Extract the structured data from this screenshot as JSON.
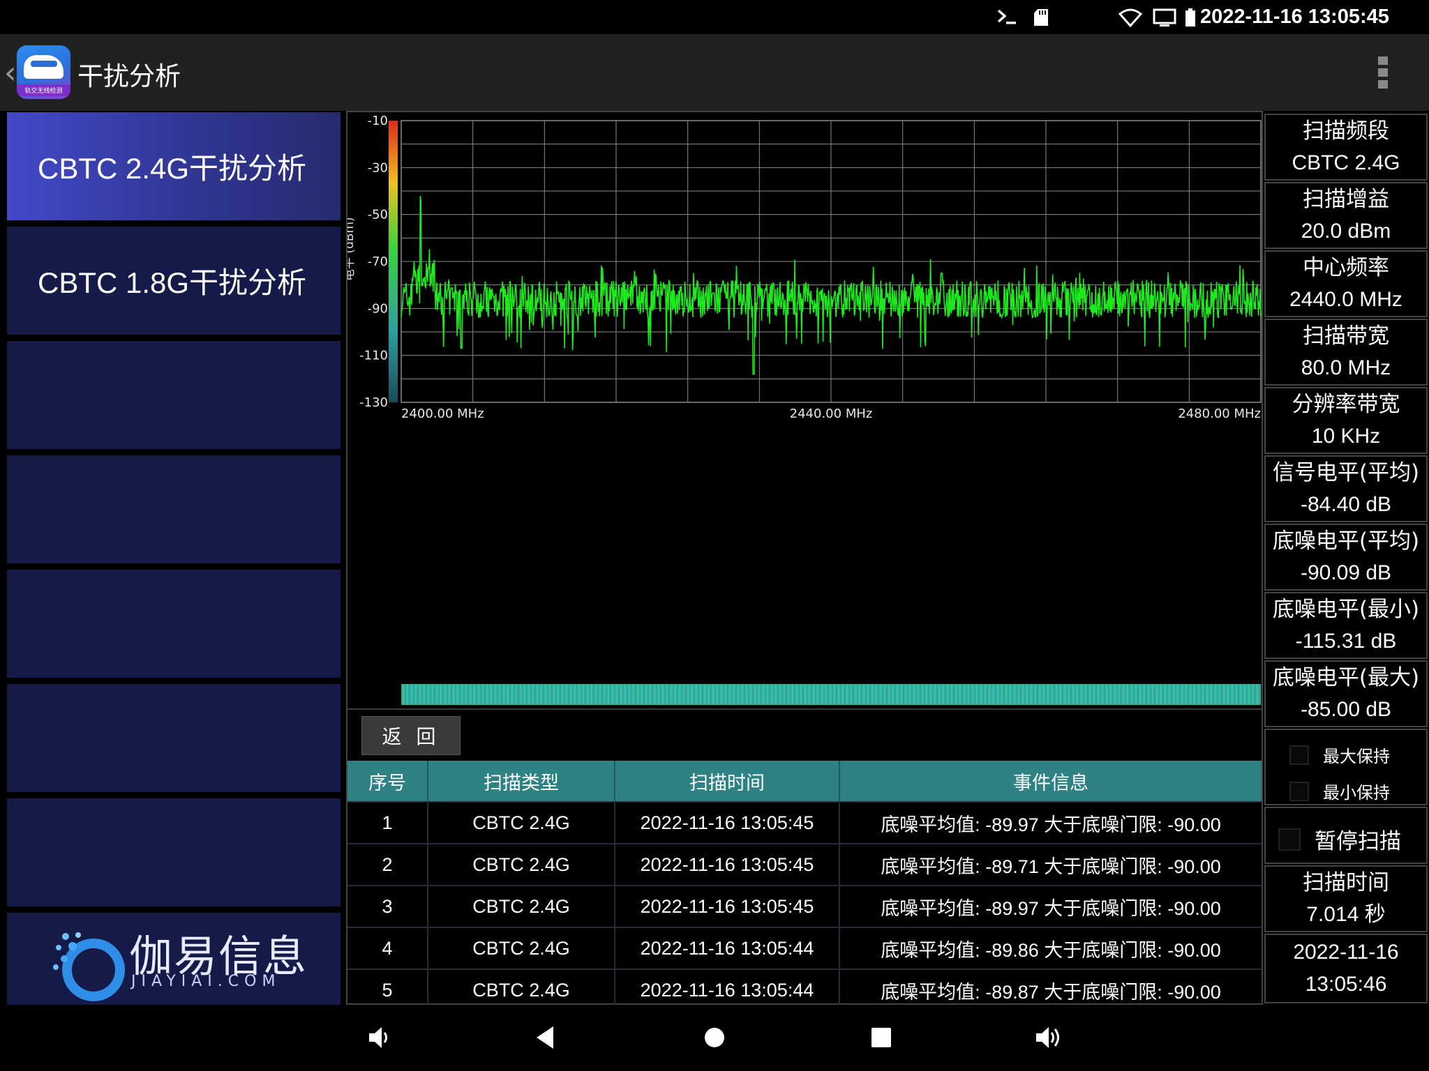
{
  "status_bar": {
    "time": "2022-11-16 13:05:45"
  },
  "app_bar": {
    "title": "干扰分析",
    "logo_caption": "轨交无线检测"
  },
  "sidebar": {
    "items": [
      {
        "label": "CBTC 2.4G干扰分析",
        "active": true
      },
      {
        "label": "CBTC 1.8G干扰分析",
        "active": false
      },
      {
        "label": ""
      },
      {
        "label": ""
      },
      {
        "label": ""
      },
      {
        "label": ""
      },
      {
        "label": ""
      }
    ],
    "brand_cn": "伽易信息",
    "brand_en": "JIAYIAI.COM"
  },
  "chart_data": {
    "type": "line",
    "ylabel": "电平 (dBm)",
    "ylim": [
      -130,
      -10
    ],
    "y_ticks": [
      "-10",
      "-30",
      "-50",
      "-70",
      "-90",
      "-110",
      "-130"
    ],
    "x_ticks": [
      "2400.00 MHz",
      "2440.00 MHz",
      "2480.00 MHz"
    ],
    "xlim": [
      2400,
      2480
    ],
    "series_color": "#1ee81e",
    "noise_floor_dbm": -90,
    "spikes": [
      {
        "x": 2401.8,
        "y": -52
      },
      {
        "x": 2405.6,
        "y": -107
      },
      {
        "x": 2432.8,
        "y": -118
      },
      {
        "x": 2450.3,
        "y": -75
      }
    ],
    "grid": true
  },
  "controls": {
    "back_label": "返 回"
  },
  "table": {
    "headers": [
      "序号",
      "扫描类型",
      "扫描时间",
      "事件信息"
    ],
    "rows": [
      [
        "1",
        "CBTC 2.4G",
        "2022-11-16 13:05:45",
        "底噪平均值: -89.97 大于底噪门限: -90.00"
      ],
      [
        "2",
        "CBTC 2.4G",
        "2022-11-16 13:05:45",
        "底噪平均值: -89.71 大于底噪门限: -90.00"
      ],
      [
        "3",
        "CBTC 2.4G",
        "2022-11-16 13:05:45",
        "底噪平均值: -89.97 大于底噪门限: -90.00"
      ],
      [
        "4",
        "CBTC 2.4G",
        "2022-11-16 13:05:44",
        "底噪平均值: -89.86 大于底噪门限: -90.00"
      ],
      [
        "5",
        "CBTC 2.4G",
        "2022-11-16 13:05:44",
        "底噪平均值: -89.87 大于底噪门限: -90.00"
      ]
    ]
  },
  "info_panel": {
    "items": [
      {
        "label": "扫描频段",
        "value": "CBTC 2.4G"
      },
      {
        "label": "扫描增益",
        "value": "20.0 dBm"
      },
      {
        "label": "中心频率",
        "value": "2440.0 MHz"
      },
      {
        "label": "扫描带宽",
        "value": "80.0 MHz"
      },
      {
        "label": "分辨率带宽",
        "value": "10 KHz"
      },
      {
        "label": "信号电平(平均)",
        "value": "-84.40 dB"
      },
      {
        "label": "底噪电平(平均)",
        "value": "-90.09 dB"
      },
      {
        "label": "底噪电平(最小)",
        "value": "-115.31 dB"
      },
      {
        "label": "底噪电平(最大)",
        "value": "-85.00 dB"
      }
    ],
    "max_hold_label": "最大保持",
    "min_hold_label": "最小保持",
    "pause_label": "暂停扫描",
    "scan_time_label": "扫描时间",
    "scan_time_value": "7.014 秒",
    "date": "2022-11-16",
    "time": "13:05:46"
  }
}
